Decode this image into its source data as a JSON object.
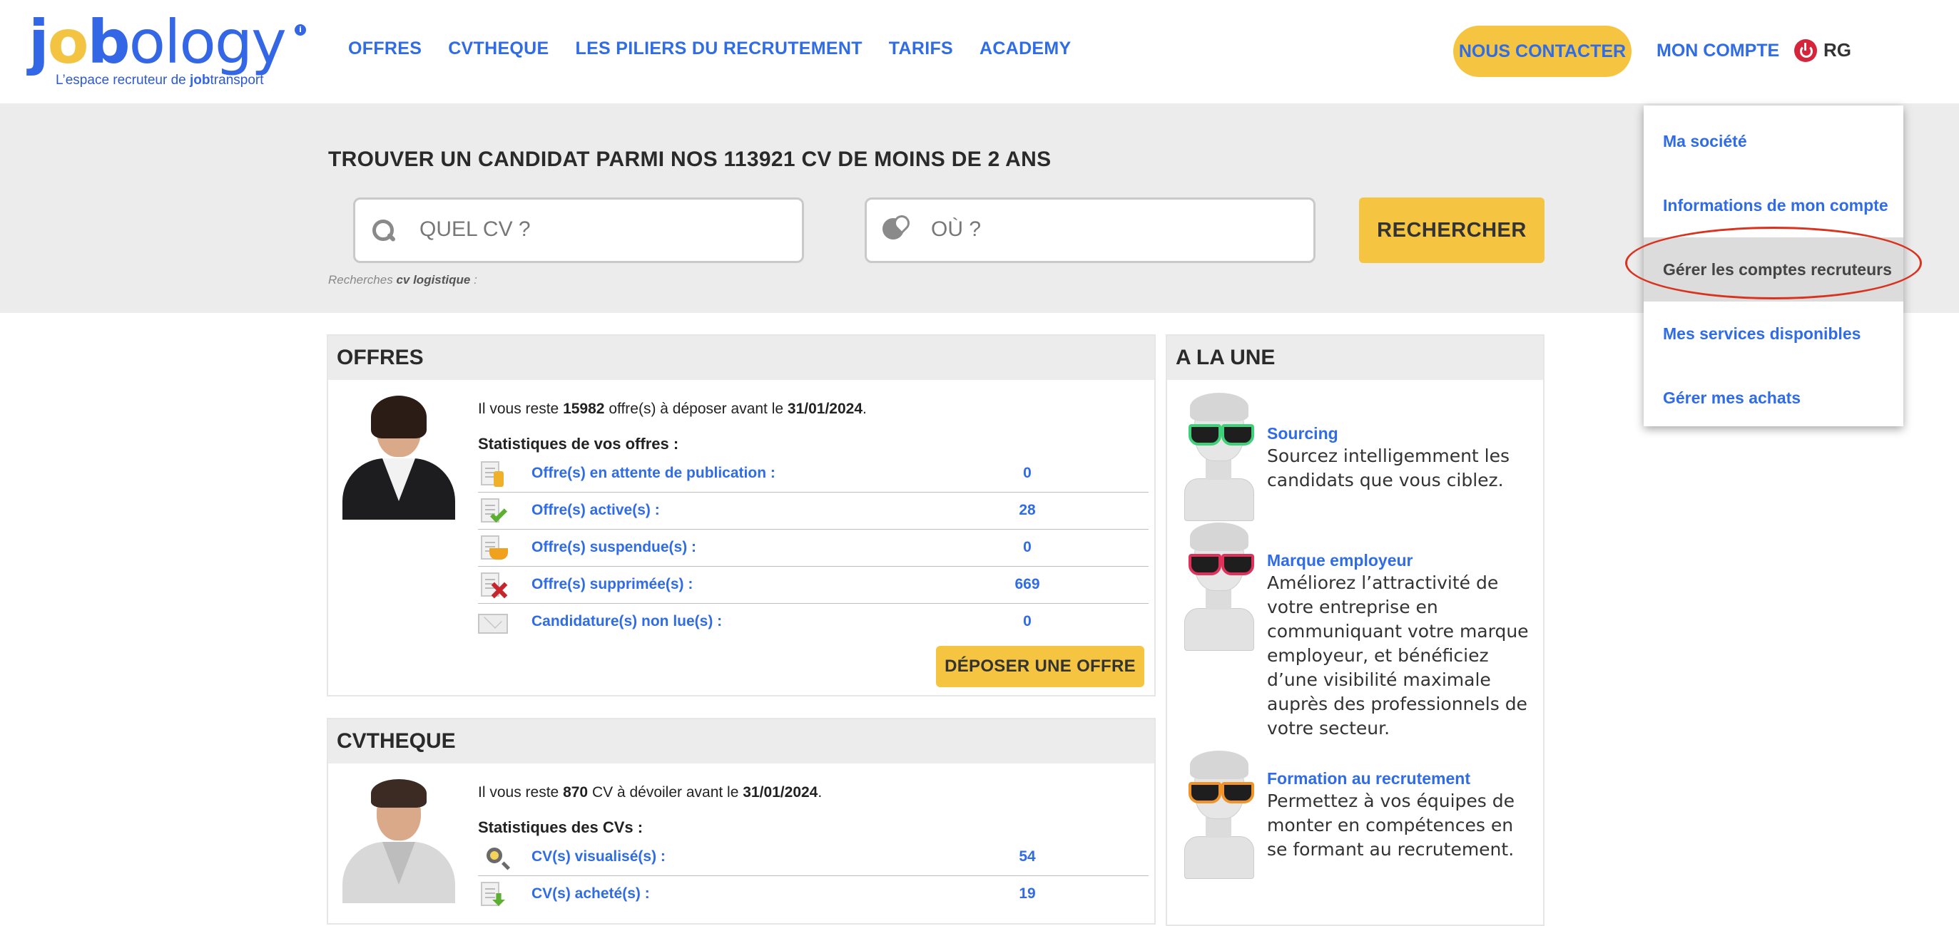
{
  "header": {
    "logo_word": "jobology",
    "logo_tagline_prefix": "L’espace recruteur de ",
    "logo_tagline_brand": "job",
    "logo_tagline_suffix": "transport",
    "nav": [
      {
        "label": "OFFRES"
      },
      {
        "label": "CVTHEQUE"
      },
      {
        "label": "LES PILIERS DU RECRUTEMENT"
      },
      {
        "label": "TARIFS"
      },
      {
        "label": "ACADEMY"
      }
    ],
    "contact_label": "NOUS CONTACTER",
    "account_label": "MON COMPTE",
    "user_initials": "RG"
  },
  "account_menu": {
    "items": [
      {
        "label": "Ma société"
      },
      {
        "label": "Informations de mon compte"
      },
      {
        "label": "Gérer les comptes recruteurs"
      },
      {
        "label": "Mes services disponibles"
      },
      {
        "label": "Gérer mes achats"
      }
    ],
    "active_index": 2
  },
  "search": {
    "title": "TROUVER UN CANDIDAT PARMI NOS 113921 CV DE MOINS DE 2 ANS",
    "what_placeholder": "QUEL CV ?",
    "where_placeholder": "OÙ ?",
    "button_label": "RECHERCHER",
    "recent_prefix": "Recherches",
    "recent_term": "cv logistique",
    "recent_suffix": ":"
  },
  "offres": {
    "title": "OFFRES",
    "remaining_prefix": "Il vous reste",
    "remaining_count": "15982",
    "remaining_middle": "offre(s) à déposer avant le",
    "remaining_date": "31/01/2024",
    "remaining_end": ".",
    "stats_title": "Statistiques de vos offres :",
    "stats": [
      {
        "label": "Offre(s) en attente de publication :",
        "value": "0",
        "icon": "pending-doc-icon"
      },
      {
        "label": "Offre(s) active(s) :",
        "value": "28",
        "icon": "active-doc-icon"
      },
      {
        "label": "Offre(s) suspendue(s) :",
        "value": "0",
        "icon": "suspended-doc-icon"
      },
      {
        "label": "Offre(s) supprimée(s) :",
        "value": "669",
        "icon": "deleted-doc-icon"
      },
      {
        "label": "Candidature(s) non lue(s) :",
        "value": "0",
        "icon": "envelope-icon"
      }
    ],
    "button_label": "DÉPOSER UNE OFFRE"
  },
  "cvtheque": {
    "title": "CVTHEQUE",
    "remaining_prefix": "Il vous reste",
    "remaining_count": "870",
    "remaining_middle": "CV à dévoiler avant le",
    "remaining_date": "31/01/2024",
    "remaining_end": ".",
    "stats_title": "Statistiques des CVs :",
    "stats": [
      {
        "label": "CV(s) visualisé(s) :",
        "value": "54",
        "icon": "cv-search-icon"
      },
      {
        "label": "CV(s) acheté(s) :",
        "value": "19",
        "icon": "cv-download-icon"
      }
    ]
  },
  "alaune": {
    "title": "A LA UNE",
    "items": [
      {
        "title": "Sourcing",
        "text": "Sourcez intelligemment les candidats que vous ciblez.",
        "glasses_color": "#3fd07a"
      },
      {
        "title": "Marque employeur",
        "text": "Améliorez l’attractivité de votre entreprise en communiquant votre marque employeur, et bénéficiez d’une visibilité maximale auprès des professionnels de votre secteur.",
        "glasses_color": "#e0315a"
      },
      {
        "title": "Formation au recrutement",
        "text": "Permettez à vos équipes de monter en compétences en se formant au recrutement.",
        "glasses_color": "#f0932a"
      }
    ]
  },
  "colors": {
    "brand_blue": "#2f6ce5",
    "accent_yellow": "#f5c542",
    "highlight_red": "#d9331f"
  }
}
